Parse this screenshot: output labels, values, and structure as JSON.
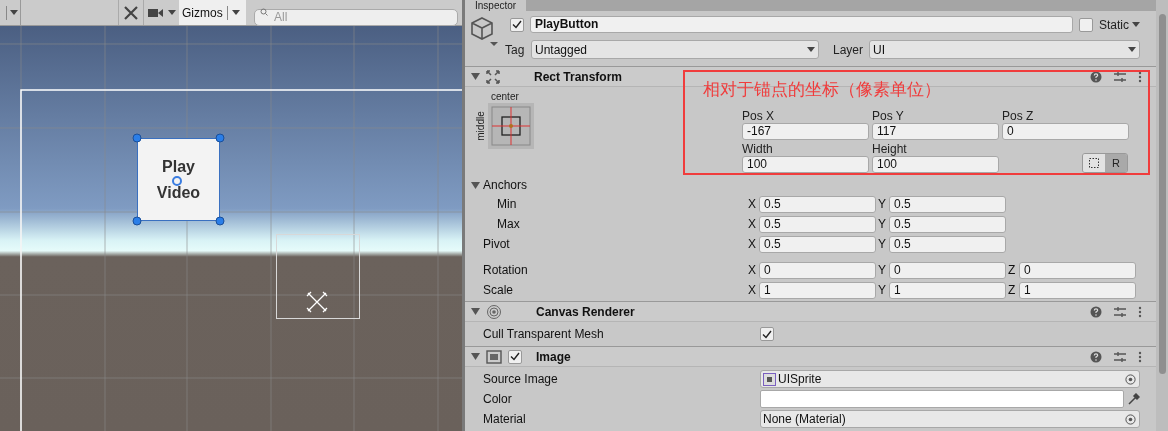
{
  "scene_view": {
    "toolbar": {
      "gizmos": "Gizmos",
      "search_placeholder": "All"
    },
    "canvas_button": {
      "lines": [
        "Play",
        "Video"
      ],
      "selected": true
    }
  },
  "inspector": {
    "tab": "Inspector",
    "object": {
      "active": true,
      "name": "PlayButton",
      "static_label": "Static",
      "static": false,
      "tag_label": "Tag",
      "tag": "Untagged",
      "layer_label": "Layer",
      "layer": "UI"
    },
    "components": [
      {
        "kind": "rect_transform",
        "title": "Rect Transform",
        "expanded": true,
        "anchor_preset": {
          "horizontal": "center",
          "vertical": "middle"
        },
        "annotation": "相对于锚点的坐标（像素单位）",
        "position": [
          {
            "label": "Pos X",
            "value": "-167"
          },
          {
            "label": "Pos Y",
            "value": "117"
          },
          {
            "label": "Pos Z",
            "value": "0"
          }
        ],
        "size": [
          {
            "label": "Width",
            "value": "100"
          },
          {
            "label": "Height",
            "value": "100"
          }
        ],
        "mode_buttons": [
          {
            "kind": "blueprint",
            "selected": false
          },
          {
            "kind": "raw",
            "label": "R",
            "selected": true
          }
        ],
        "anchors": {
          "label": "Anchors",
          "expanded": true,
          "rows": [
            {
              "label": "Min",
              "axes": [
                {
                  "axis": "X",
                  "value": "0.5"
                },
                {
                  "axis": "Y",
                  "value": "0.5"
                }
              ]
            },
            {
              "label": "Max",
              "axes": [
                {
                  "axis": "X",
                  "value": "0.5"
                },
                {
                  "axis": "Y",
                  "value": "0.5"
                }
              ]
            }
          ]
        },
        "rows": [
          {
            "label": "Pivot",
            "axes": [
              {
                "axis": "X",
                "value": "0.5"
              },
              {
                "axis": "Y",
                "value": "0.5"
              }
            ]
          },
          {
            "label": "Rotation",
            "axes": [
              {
                "axis": "X",
                "value": "0"
              },
              {
                "axis": "Y",
                "value": "0"
              },
              {
                "axis": "Z",
                "value": "0"
              }
            ]
          },
          {
            "label": "Scale",
            "axes": [
              {
                "axis": "X",
                "value": "1"
              },
              {
                "axis": "Y",
                "value": "1"
              },
              {
                "axis": "Z",
                "value": "1"
              }
            ]
          }
        ]
      },
      {
        "kind": "canvas_renderer",
        "title": "Canvas Renderer",
        "expanded": true,
        "properties": [
          {
            "kind": "checkbox",
            "label": "Cull Transparent Mesh",
            "checked": true
          }
        ]
      },
      {
        "kind": "image",
        "title": "Image",
        "expanded": true,
        "enabled": true,
        "properties": [
          {
            "kind": "object",
            "label": "Source Image",
            "value": "UISprite",
            "has_icon": true
          },
          {
            "kind": "color",
            "label": "Color",
            "color": "#ffffff"
          },
          {
            "kind": "object",
            "label": "Material",
            "value": "None (Material)",
            "has_icon": false
          }
        ]
      }
    ]
  }
}
